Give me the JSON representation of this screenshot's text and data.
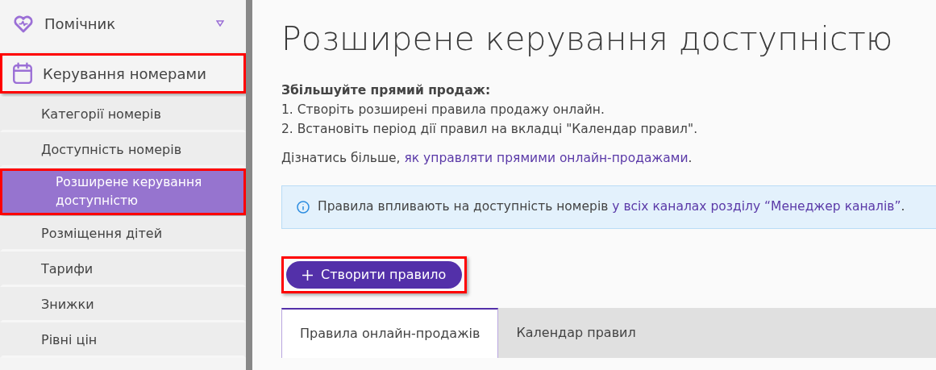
{
  "sidebar": {
    "items": [
      {
        "kind": "section",
        "label": "Помічник",
        "highlighted": false,
        "selected": false
      },
      {
        "kind": "section",
        "label": "Керування номерами",
        "highlighted": true,
        "selected": false
      },
      {
        "kind": "sub",
        "label": "Категорії номерів",
        "highlighted": false,
        "selected": false
      },
      {
        "kind": "sub",
        "label": "Доступність номерів",
        "highlighted": false,
        "selected": false
      },
      {
        "kind": "sub",
        "label": "Розширене керування доступністю",
        "highlighted": true,
        "selected": true
      },
      {
        "kind": "sub",
        "label": "Розміщення дітей",
        "highlighted": false,
        "selected": false
      },
      {
        "kind": "sub",
        "label": "Тарифи",
        "highlighted": false,
        "selected": false
      },
      {
        "kind": "sub",
        "label": "Знижки",
        "highlighted": false,
        "selected": false
      },
      {
        "kind": "sub",
        "label": "Рівні цін",
        "highlighted": false,
        "selected": false
      }
    ]
  },
  "main": {
    "title": "Розширене керування доступністю",
    "intro_heading": "Збільшуйте прямий продаж:",
    "steps": [
      "1. Створіть розширені правила продажу онлайн.",
      "2. Встановіть період дії правил на вкладці \"Календар правил\"."
    ],
    "learn_more": {
      "text": "Дізнатись більше, ",
      "link": "як управляти прямими онлайн-продажами",
      "after": "."
    },
    "info": {
      "text": "Правила впливають на доступність номерів ",
      "link": "у всіх каналах розділу “Менеджер каналів”",
      "after": "."
    },
    "create_button": {
      "label": "Створити правило",
      "highlighted": true
    },
    "tabs": [
      {
        "label": "Правила онлайн-продажів",
        "selected": true
      },
      {
        "label": "Календар правил",
        "selected": false
      }
    ]
  }
}
